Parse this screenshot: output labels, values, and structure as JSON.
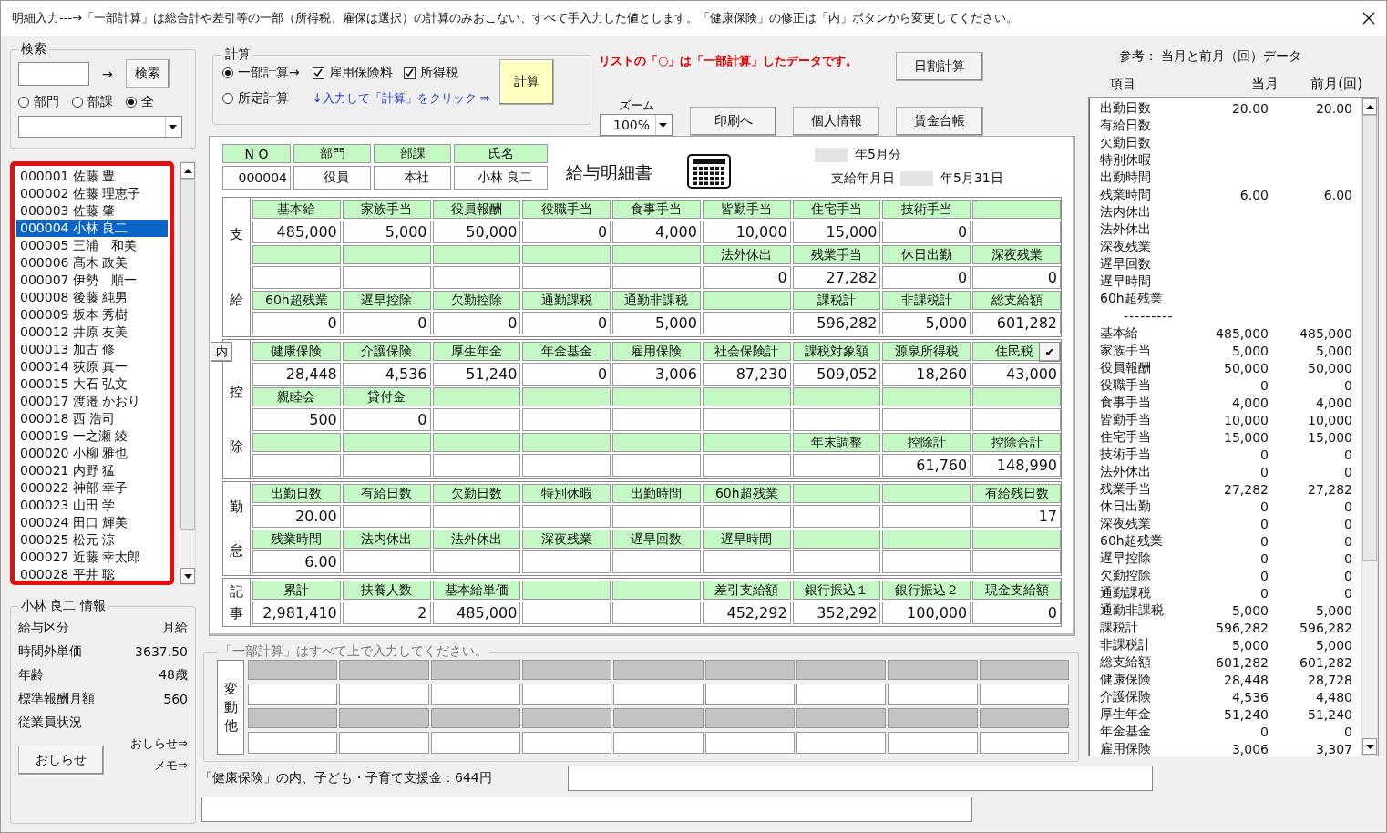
{
  "window": {
    "title": "明細入力---→「一部計算」は総合計や差引等の一部（所得税、雇保は選択）の計算のみおこない、すべて手入力した値とします。「健康保険」の修正は「内」ボタンから変更してください。"
  },
  "search": {
    "title": "検索",
    "arrow": "→",
    "button": "検索",
    "scopes": [
      {
        "label": "部門",
        "selected": false
      },
      {
        "label": "部課",
        "selected": false
      },
      {
        "label": "全",
        "selected": true
      }
    ]
  },
  "employees": [
    {
      "label": "000001 佐藤 豊",
      "selected": false
    },
    {
      "label": "000002 佐藤 理恵子",
      "selected": false
    },
    {
      "label": "000003 佐藤 肇",
      "selected": false
    },
    {
      "label": "000004 小林 良二",
      "selected": true
    },
    {
      "label": "000005 三浦　和美",
      "selected": false
    },
    {
      "label": "000006 髙木 政美",
      "selected": false
    },
    {
      "label": "000007 伊勢　順一",
      "selected": false
    },
    {
      "label": "000008 後藤 純男",
      "selected": false
    },
    {
      "label": "000009 坂本 秀樹",
      "selected": false
    },
    {
      "label": "000012 井原 友美",
      "selected": false
    },
    {
      "label": "000013 加古 修",
      "selected": false
    },
    {
      "label": "000014 荻原 真一",
      "selected": false
    },
    {
      "label": "000015 大石 弘文",
      "selected": false
    },
    {
      "label": "000017 渡邉 かおり",
      "selected": false
    },
    {
      "label": "000018 西 浩司",
      "selected": false
    },
    {
      "label": "000019 一之瀬 綾",
      "selected": false
    },
    {
      "label": "000020 小柳 雅也",
      "selected": false
    },
    {
      "label": "000021 内野 猛",
      "selected": false
    },
    {
      "label": "000022 神部 幸子",
      "selected": false
    },
    {
      "label": "000023 山田 学",
      "selected": false
    },
    {
      "label": "000024 田口 輝美",
      "selected": false
    },
    {
      "label": "000025 松元 涼",
      "selected": false
    },
    {
      "label": "000027 近藤 幸太郎",
      "selected": false
    },
    {
      "label": "000028 平井 聡",
      "selected": false
    }
  ],
  "employee_info": {
    "title": "小林 良二 情報",
    "rows": [
      {
        "label": "給与区分",
        "value": "月給"
      },
      {
        "label": "時間外単価",
        "value": "3637.50"
      },
      {
        "label": "年齢",
        "value": "48歳"
      },
      {
        "label": "標準報酬月額",
        "value": "560"
      },
      {
        "label": "従業員状況"
      }
    ],
    "notice_button": "おしらせ",
    "links": [
      "おしらせ⇒",
      "メモ⇒"
    ]
  },
  "calc": {
    "title": "計算",
    "modes": [
      {
        "label": "一部計算→",
        "selected": true
      },
      {
        "label": "所定計算",
        "selected": false
      }
    ],
    "options": [
      {
        "label": "雇用保険料",
        "checked": true
      },
      {
        "label": "所得税",
        "checked": true
      }
    ],
    "button": "計算",
    "hint": "↓入力して「計算」をクリック ⇒"
  },
  "notice": "リストの「○」は「一部計算」したデータです。",
  "zoom": {
    "label": "ズーム",
    "value": "100%"
  },
  "buttons": {
    "daily": "日割計算",
    "print": "印刷へ",
    "personal": "個人情報",
    "ledger": "賃金台帳"
  },
  "slip": {
    "id_columns": [
      "N O",
      "部門",
      "部課",
      "氏名"
    ],
    "id_values": [
      "000004",
      "役員",
      "本社",
      "小林 良二"
    ],
    "title": "給与明細書",
    "period": "年5月分",
    "pay_date_label": "支給年月日",
    "pay_date": "年5月31日",
    "internal_button": "内",
    "check_button": "✔",
    "sections": [
      {
        "label": "支給",
        "rows": [
          {
            "kind": "header",
            "cells": [
              "基本給",
              "家族手当",
              "役員報酬",
              "役職手当",
              "食事手当",
              "皆勤手当",
              "住宅手当",
              "技術手当",
              null
            ]
          },
          {
            "kind": "value",
            "cells": [
              "485,000",
              "5,000",
              "50,000",
              "0",
              "4,000",
              "10,000",
              "15,000",
              "0",
              null
            ]
          },
          {
            "kind": "header",
            "cells": [
              null,
              null,
              null,
              null,
              null,
              "法外休出",
              "残業手当",
              "休日出勤",
              "深夜残業"
            ]
          },
          {
            "kind": "value",
            "cells": [
              null,
              null,
              null,
              null,
              null,
              "0",
              "27,282",
              "0",
              "0"
            ]
          },
          {
            "kind": "header",
            "cells": [
              "60h超残業",
              "遅早控除",
              "欠勤控除",
              "通勤課税",
              "通勤非課税",
              null,
              "課税計",
              "非課税計",
              "総支給額"
            ]
          },
          {
            "kind": "value",
            "cells": [
              "0",
              "0",
              "0",
              "0",
              "5,000",
              null,
              "596,282",
              "5,000",
              "601,282"
            ]
          }
        ]
      },
      {
        "label": "控除",
        "rows": [
          {
            "kind": "header",
            "cells": [
              "健康保険",
              "介護保険",
              "厚生年金",
              "年金基金",
              "雇用保険",
              "社会保険計",
              "課税対象額",
              "源泉所得税",
              "住民税"
            ]
          },
          {
            "kind": "value",
            "cells": [
              "28,448",
              "4,536",
              "51,240",
              "0",
              "3,006",
              "87,230",
              "509,052",
              "18,260",
              "43,000"
            ]
          },
          {
            "kind": "header",
            "cells": [
              "親睦会",
              "貸付金",
              null,
              null,
              null,
              null,
              null,
              null,
              null
            ]
          },
          {
            "kind": "value",
            "cells": [
              "500",
              "0",
              null,
              null,
              null,
              null,
              null,
              null,
              null
            ]
          },
          {
            "kind": "header",
            "cells": [
              null,
              null,
              null,
              null,
              null,
              null,
              "年末調整",
              "控除計",
              "控除合計"
            ]
          },
          {
            "kind": "value",
            "cells": [
              null,
              null,
              null,
              null,
              null,
              null,
              null,
              "61,760",
              "148,990"
            ]
          }
        ]
      },
      {
        "label": "勤怠",
        "rows": [
          {
            "kind": "header",
            "cells": [
              "出勤日数",
              "有給日数",
              "欠勤日数",
              "特別休暇",
              "出勤時間",
              "60h超残業",
              null,
              null,
              "有給残日数"
            ]
          },
          {
            "kind": "value",
            "cells": [
              "20.00",
              null,
              null,
              null,
              null,
              null,
              null,
              null,
              "17"
            ]
          },
          {
            "kind": "header",
            "cells": [
              "残業時間",
              "法内休出",
              "法外休出",
              "深夜残業",
              "遅早回数",
              "遅早時間",
              null,
              null,
              null
            ]
          },
          {
            "kind": "value",
            "cells": [
              "6.00",
              null,
              null,
              null,
              null,
              null,
              null,
              null,
              null
            ]
          }
        ]
      },
      {
        "label": "記事",
        "rows": [
          {
            "kind": "header",
            "cells": [
              "累計",
              "扶養人数",
              "基本給単価",
              null,
              null,
              "差引支給額",
              "銀行振込１",
              "銀行振込２",
              "現金支給額"
            ]
          },
          {
            "kind": "value",
            "cells": [
              "2,981,410",
              "2",
              "485,000",
              null,
              null,
              "452,292",
              "352,292",
              "100,000",
              "0"
            ]
          }
        ]
      }
    ]
  },
  "variable": {
    "title": "「一部計算」はすべて上で入力してください。",
    "label": "変動他"
  },
  "child_support_note": "「健康保険」の内、子ども・子育て支援金：644円",
  "reference": {
    "title": "参考： 当月と前月（回）データ",
    "columns": [
      "項目",
      "当月",
      "前月(回)"
    ],
    "rows": [
      {
        "kind": "row",
        "item": "出勤日数",
        "current": "20.00",
        "previous": "20.00"
      },
      {
        "kind": "row",
        "item": "有給日数"
      },
      {
        "kind": "row",
        "item": "欠勤日数"
      },
      {
        "kind": "row",
        "item": "特別休暇"
      },
      {
        "kind": "row",
        "item": "出勤時間"
      },
      {
        "kind": "row",
        "item": "残業時間",
        "current": "6.00",
        "previous": "6.00"
      },
      {
        "kind": "row",
        "item": "法内休出"
      },
      {
        "kind": "row",
        "item": "法外休出"
      },
      {
        "kind": "row",
        "item": "深夜残業"
      },
      {
        "kind": "row",
        "item": "遅早回数"
      },
      {
        "kind": "row",
        "item": "遅早時間"
      },
      {
        "kind": "row",
        "item": "60h超残業"
      },
      {
        "kind": "separator",
        "item": "---------"
      },
      {
        "kind": "row",
        "item": "基本給",
        "current": "485,000",
        "previous": "485,000"
      },
      {
        "kind": "row",
        "item": "家族手当",
        "current": "5,000",
        "previous": "5,000"
      },
      {
        "kind": "row",
        "item": "役員報酬",
        "current": "50,000",
        "previous": "50,000"
      },
      {
        "kind": "row",
        "item": "役職手当",
        "current": "0",
        "previous": "0"
      },
      {
        "kind": "row",
        "item": "食事手当",
        "current": "4,000",
        "previous": "4,000"
      },
      {
        "kind": "row",
        "item": "皆勤手当",
        "current": "10,000",
        "previous": "10,000"
      },
      {
        "kind": "row",
        "item": "住宅手当",
        "current": "15,000",
        "previous": "15,000"
      },
      {
        "kind": "row",
        "item": "技術手当",
        "current": "0",
        "previous": "0"
      },
      {
        "kind": "row",
        "item": "法外休出",
        "current": "0",
        "previous": "0"
      },
      {
        "kind": "row",
        "item": "残業手当",
        "current": "27,282",
        "previous": "27,282"
      },
      {
        "kind": "row",
        "item": "休日出勤",
        "current": "0",
        "previous": "0"
      },
      {
        "kind": "row",
        "item": "深夜残業",
        "current": "0",
        "previous": "0"
      },
      {
        "kind": "row",
        "item": "60h超残業",
        "current": "0",
        "previous": "0"
      },
      {
        "kind": "row",
        "item": "遅早控除",
        "current": "0",
        "previous": "0"
      },
      {
        "kind": "row",
        "item": "欠勤控除",
        "current": "0",
        "previous": "0"
      },
      {
        "kind": "row",
        "item": "通勤課税",
        "current": "0",
        "previous": "0"
      },
      {
        "kind": "row",
        "item": "通勤非課税",
        "current": "5,000",
        "previous": "5,000"
      },
      {
        "kind": "row",
        "item": "課税計",
        "current": "596,282",
        "previous": "596,282"
      },
      {
        "kind": "row",
        "item": "非課税計",
        "current": "5,000",
        "previous": "5,000"
      },
      {
        "kind": "row",
        "item": "総支給額",
        "current": "601,282",
        "previous": "601,282"
      },
      {
        "kind": "row",
        "item": "健康保険",
        "current": "28,448",
        "previous": "28,728"
      },
      {
        "kind": "row",
        "item": "介護保険",
        "current": "4,536",
        "previous": "4,480"
      },
      {
        "kind": "row",
        "item": "厚生年金",
        "current": "51,240",
        "previous": "51,240"
      },
      {
        "kind": "row",
        "item": "年金基金",
        "current": "0",
        "previous": "0"
      },
      {
        "kind": "row",
        "item": "雇用保険",
        "current": "3,006",
        "previous": "3,307"
      }
    ]
  }
}
